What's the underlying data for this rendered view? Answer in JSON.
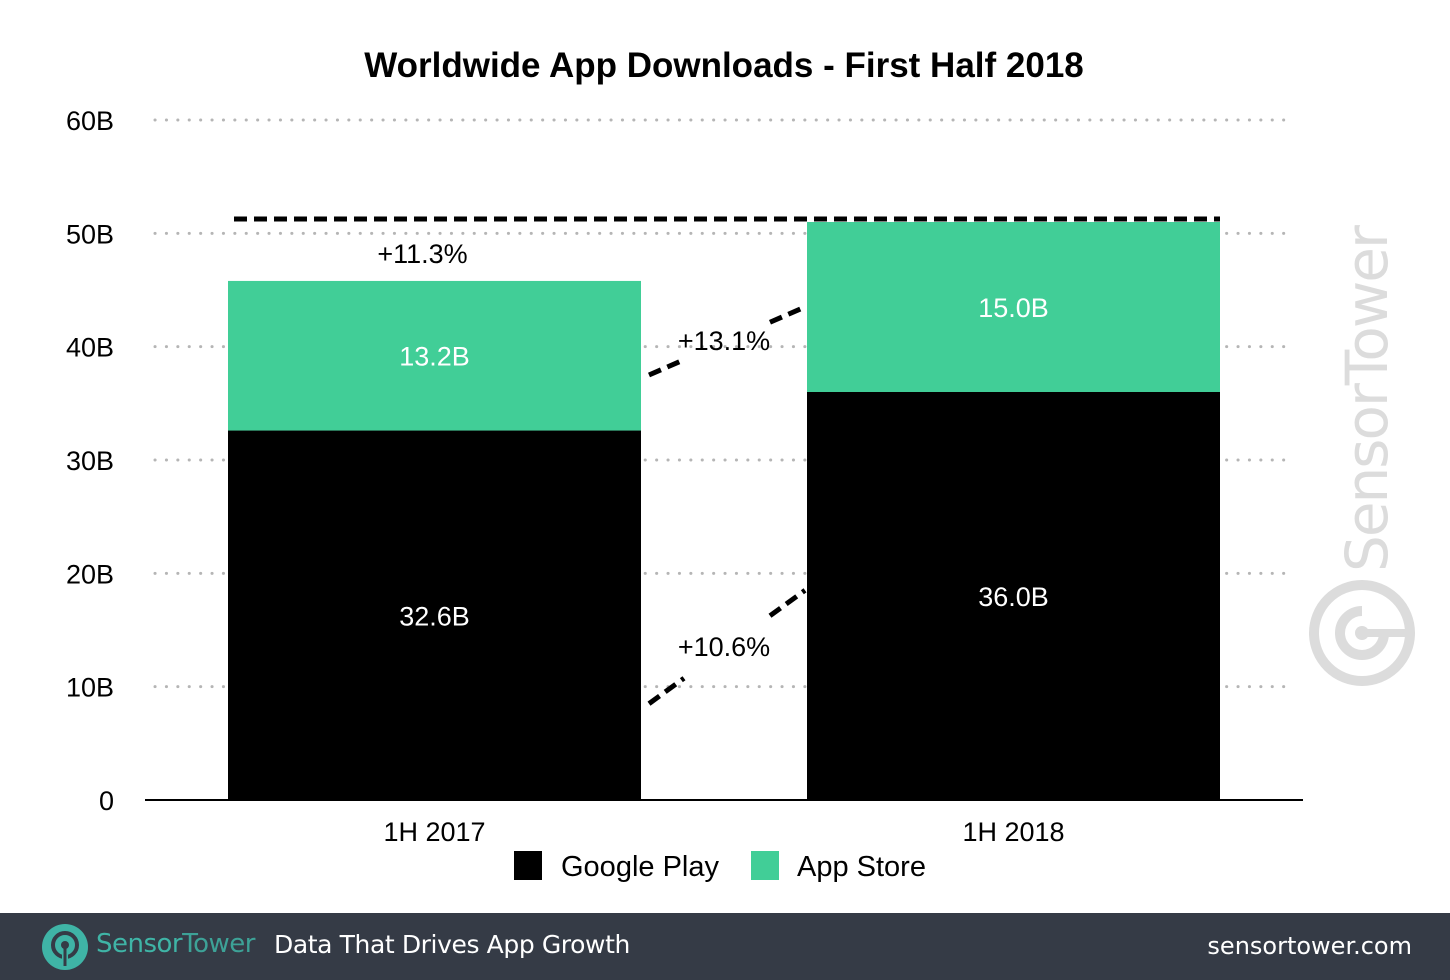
{
  "chart_data": {
    "type": "bar",
    "stacked": true,
    "title": "Worldwide App Downloads - First Half 2018",
    "xlabel": "",
    "ylabel": "",
    "categories": [
      "1H 2017",
      "1H 2018"
    ],
    "series": [
      {
        "name": "Google Play",
        "color": "#000000",
        "values": [
          32.6,
          36.0
        ],
        "labels": [
          "32.6B",
          "36.0B"
        ]
      },
      {
        "name": "App Store",
        "color": "#41ce97",
        "values": [
          13.2,
          15.0
        ],
        "labels": [
          "13.2B",
          "15.0B"
        ]
      }
    ],
    "ylim": [
      0,
      60
    ],
    "yticks": [
      0,
      10,
      20,
      30,
      40,
      50,
      60
    ],
    "ytick_labels": [
      "0",
      "10B",
      "20B",
      "30B",
      "40B",
      "50B",
      "60B"
    ],
    "grid": true,
    "legend": {
      "placement": "bottom-center",
      "entries": [
        "Google Play",
        "App Store"
      ]
    },
    "annotations": {
      "total_growth": "+11.3%",
      "app_store_growth": "+13.1%",
      "google_play_growth": "+10.6%"
    },
    "watermark": "SensorTower"
  },
  "footer": {
    "brand_part1": "Sensor",
    "brand_part2": "Tower",
    "tagline": "Data That Drives App Growth",
    "website": "sensortower.com"
  }
}
